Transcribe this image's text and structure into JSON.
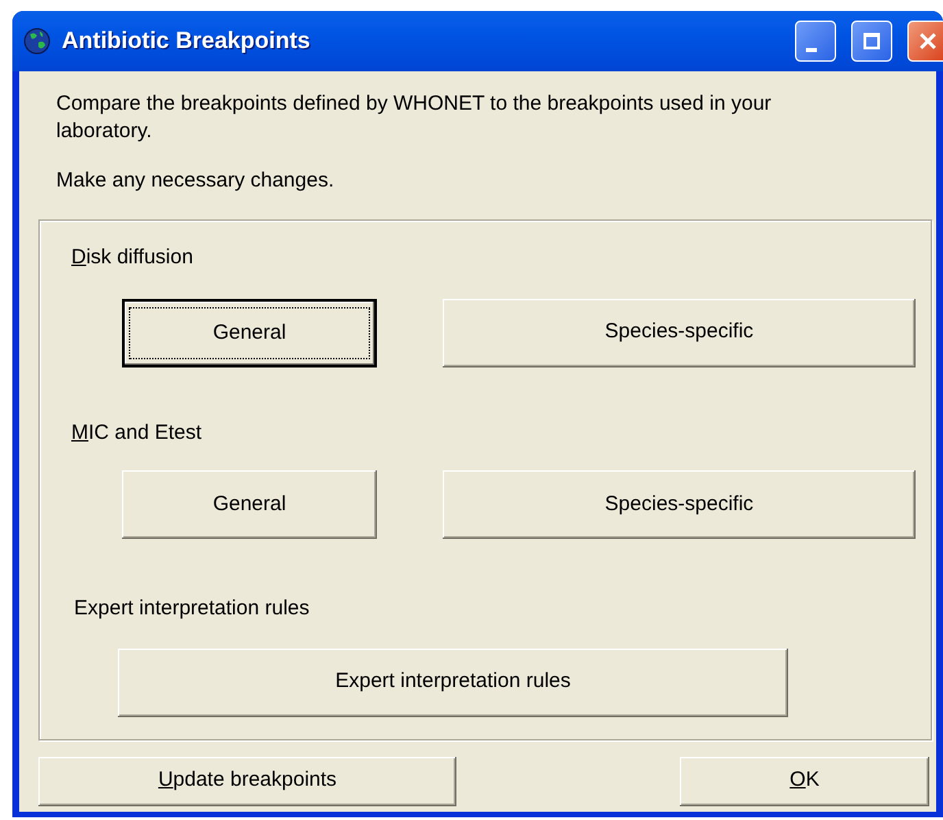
{
  "window": {
    "title": "Antibiotic Breakpoints",
    "controls": [
      {
        "kind": "minimize"
      },
      {
        "kind": "maximize"
      },
      {
        "kind": "close"
      }
    ]
  },
  "intro": "Compare the breakpoints defined by WHONET to the breakpoints used in your laboratory.",
  "instruction": "Make any necessary changes.",
  "sections": [
    {
      "label": "Disk diffusion",
      "first_letter_underlined": true,
      "buttons": [
        {
          "label": "General",
          "focused": true
        },
        {
          "label": "Species-specific",
          "focused": false
        }
      ]
    },
    {
      "label": "MIC and Etest",
      "first_letter_underlined": true,
      "buttons": [
        {
          "label": "General",
          "focused": false
        },
        {
          "label": "Species-specific",
          "focused": false
        }
      ]
    },
    {
      "label": "Expert interpretation rules",
      "first_letter_underlined": false,
      "buttons": [
        {
          "label": "Expert interpretation rules",
          "focused": false
        }
      ]
    }
  ],
  "footer_buttons": [
    {
      "label": "Update breakpoints",
      "first_letter_underlined": true,
      "focused": false
    },
    {
      "label": "OK",
      "first_letter_underlined": true,
      "focused": false
    }
  ]
}
